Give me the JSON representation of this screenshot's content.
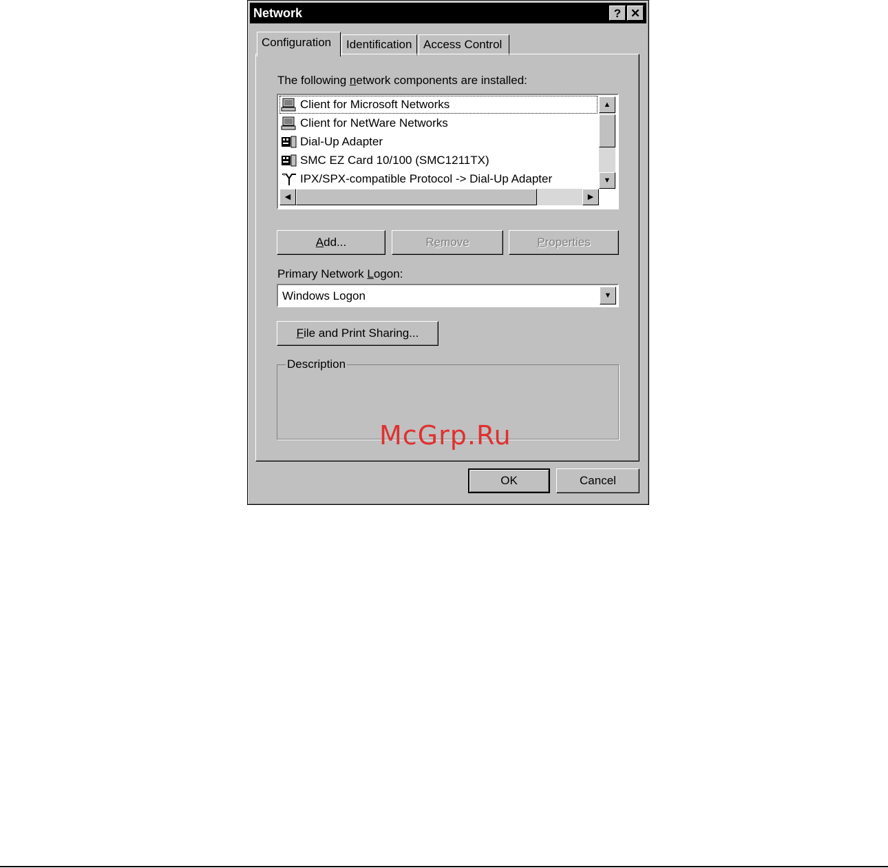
{
  "window": {
    "title": "Network",
    "help_glyph": "?",
    "close_glyph": "✕"
  },
  "tabs": [
    {
      "label": "Configuration",
      "active": true
    },
    {
      "label": "Identification",
      "active": false
    },
    {
      "label": "Access Control",
      "active": false
    }
  ],
  "components": {
    "label_pre": "The following ",
    "label_u": "n",
    "label_post": "etwork components are installed:",
    "items": [
      {
        "label": "Client for Microsoft Networks",
        "icon": "client-computer-icon",
        "selected": true
      },
      {
        "label": "Client for NetWare Networks",
        "icon": "client-computer-icon",
        "selected": false
      },
      {
        "label": "Dial-Up Adapter",
        "icon": "adapter-card-icon",
        "selected": false
      },
      {
        "label": "SMC EZ Card 10/100 (SMC1211TX)",
        "icon": "adapter-card-icon",
        "selected": false
      },
      {
        "label": "IPX/SPX-compatible Protocol -> Dial-Up Adapter",
        "icon": "protocol-icon",
        "selected": false
      }
    ]
  },
  "buttons": {
    "add_u": "A",
    "add_rest": "dd...",
    "remove_pre": "R",
    "remove_u": "e",
    "remove_rest": "move",
    "properties_u": "P",
    "properties_rest": "roperties",
    "file_print_u": "F",
    "file_print_rest": "ile and Print Sharing...",
    "ok": "OK",
    "cancel": "Cancel"
  },
  "logon": {
    "label_pre": "Primary Network ",
    "label_u": "L",
    "label_post": "ogon:",
    "value": "Windows Logon"
  },
  "description": {
    "legend": "Description"
  },
  "watermark": "McGrp.Ru"
}
